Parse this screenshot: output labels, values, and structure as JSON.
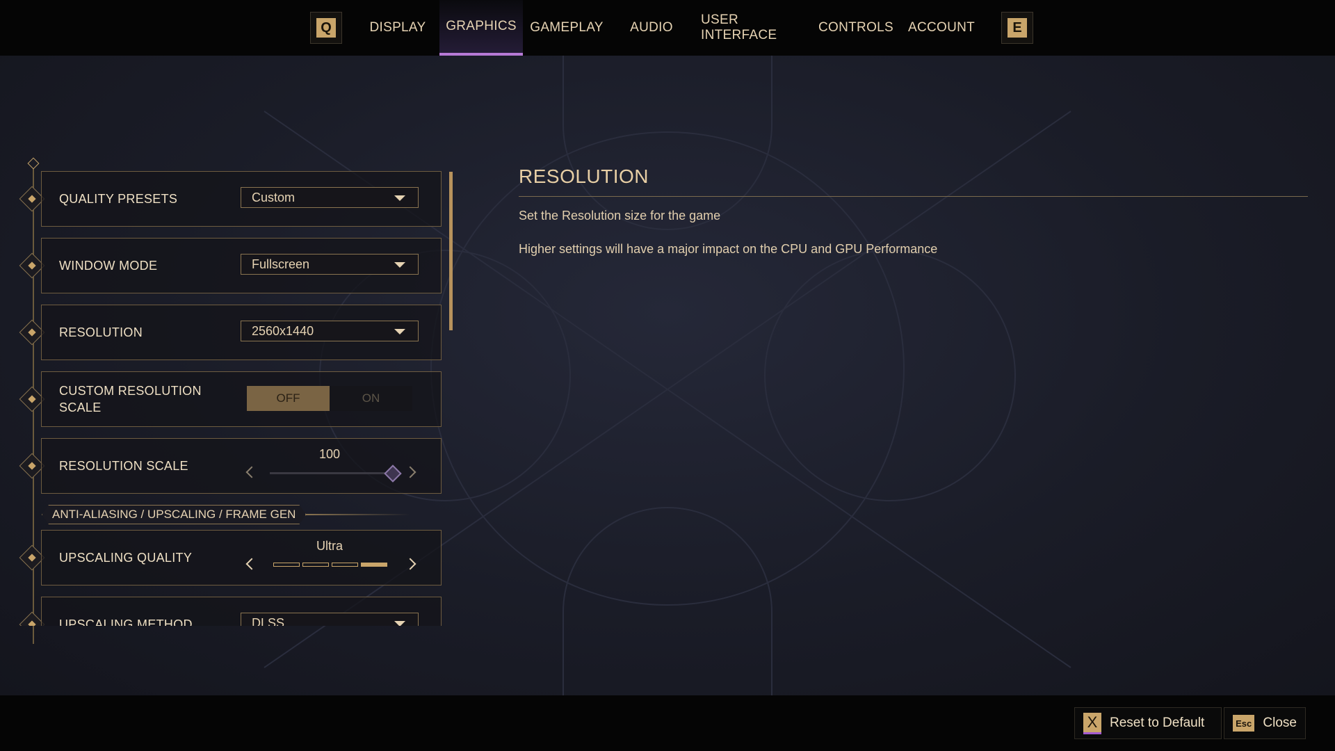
{
  "topbar": {
    "left_key": "Q",
    "right_key": "E",
    "tabs": [
      "DISPLAY",
      "GRAPHICS",
      "GAMEPLAY",
      "AUDIO",
      "USER INTERFACE",
      "CONTROLS",
      "ACCOUNT"
    ],
    "active_tab": "GRAPHICS"
  },
  "settings": {
    "quality_presets": {
      "label": "QUALITY PRESETS",
      "value": "Custom"
    },
    "window_mode": {
      "label": "WINDOW MODE",
      "value": "Fullscreen"
    },
    "resolution": {
      "label": "RESOLUTION",
      "value": "2560x1440"
    },
    "custom_resolution_scale": {
      "label": "CUSTOM RESOLUTION SCALE",
      "off": "OFF",
      "on": "ON",
      "state": "OFF"
    },
    "resolution_scale": {
      "label": "RESOLUTION SCALE",
      "value": "100",
      "fraction": 1.0
    },
    "section_header": "ANTI-ALIASING / UPSCALING / FRAME GEN",
    "upscaling_quality": {
      "label": "UPSCALING QUALITY",
      "value": "Ultra",
      "level": 4,
      "levels": 4
    },
    "upscaling_method": {
      "label": "UPSCALING METHOD",
      "value": "DLSS"
    }
  },
  "info": {
    "title": "RESOLUTION",
    "line1": "Set the Resolution size for the game",
    "line2": "Higher settings will have a major impact on the CPU and GPU Performance"
  },
  "footer": {
    "reset_key": "X",
    "reset_label": "Reset to Default",
    "close_key": "Esc",
    "close_label": "Close"
  },
  "colors": {
    "accent_gold": "#c9a56a",
    "accent_purple": "#b77ad6",
    "background": "#1a1b25"
  }
}
